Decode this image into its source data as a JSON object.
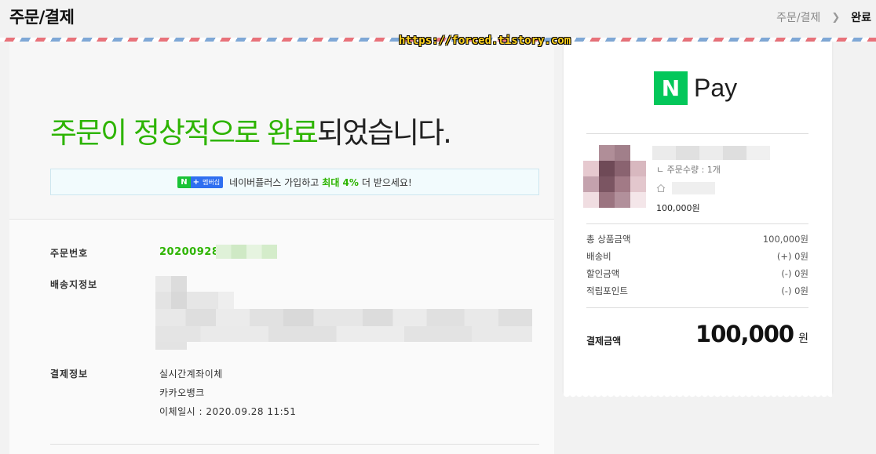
{
  "header": {
    "title": "주문/결제",
    "breadcrumb": [
      "주문/결제",
      "완료"
    ]
  },
  "watermark": "https://forced.tistory.com",
  "main": {
    "headline_green": "주문이 정상적으로 완료",
    "headline_rest": "되었습니다.",
    "promo": {
      "badge_n": "N",
      "badge_plus": "+",
      "badge_label": "멤버십",
      "text_before": "네이버플러스 가입하고",
      "text_strong": "최대 4%",
      "text_after": "더 받으세요!"
    },
    "order": {
      "label": "주문번호",
      "number": "20200928"
    },
    "shipping": {
      "label": "배송지정보"
    },
    "payment": {
      "label": "결제정보",
      "method": "실시간계좌이체",
      "bank": "카카오뱅크",
      "datetime": "이체일시 : 2020.09.28 11:51"
    }
  },
  "receipt": {
    "logo_n": "N",
    "logo_text": "Pay",
    "product": {
      "quantity": "ㄴ 주문수량 : 1개",
      "price": "100,000원"
    },
    "summary": [
      {
        "label": "총 상품금액",
        "value": "100,000원"
      },
      {
        "label": "배송비",
        "value": "(+) 0원"
      },
      {
        "label": "할인금액",
        "value": "(-) 0원"
      },
      {
        "label": "적립포인트",
        "value": "(-) 0원"
      }
    ],
    "total": {
      "label": "결제금액",
      "amount": "100,000",
      "unit": "원"
    }
  },
  "colors": {
    "accent_green": "#2db400",
    "npay_green": "#03c75a",
    "promo_bg": "#f2fbfd"
  }
}
